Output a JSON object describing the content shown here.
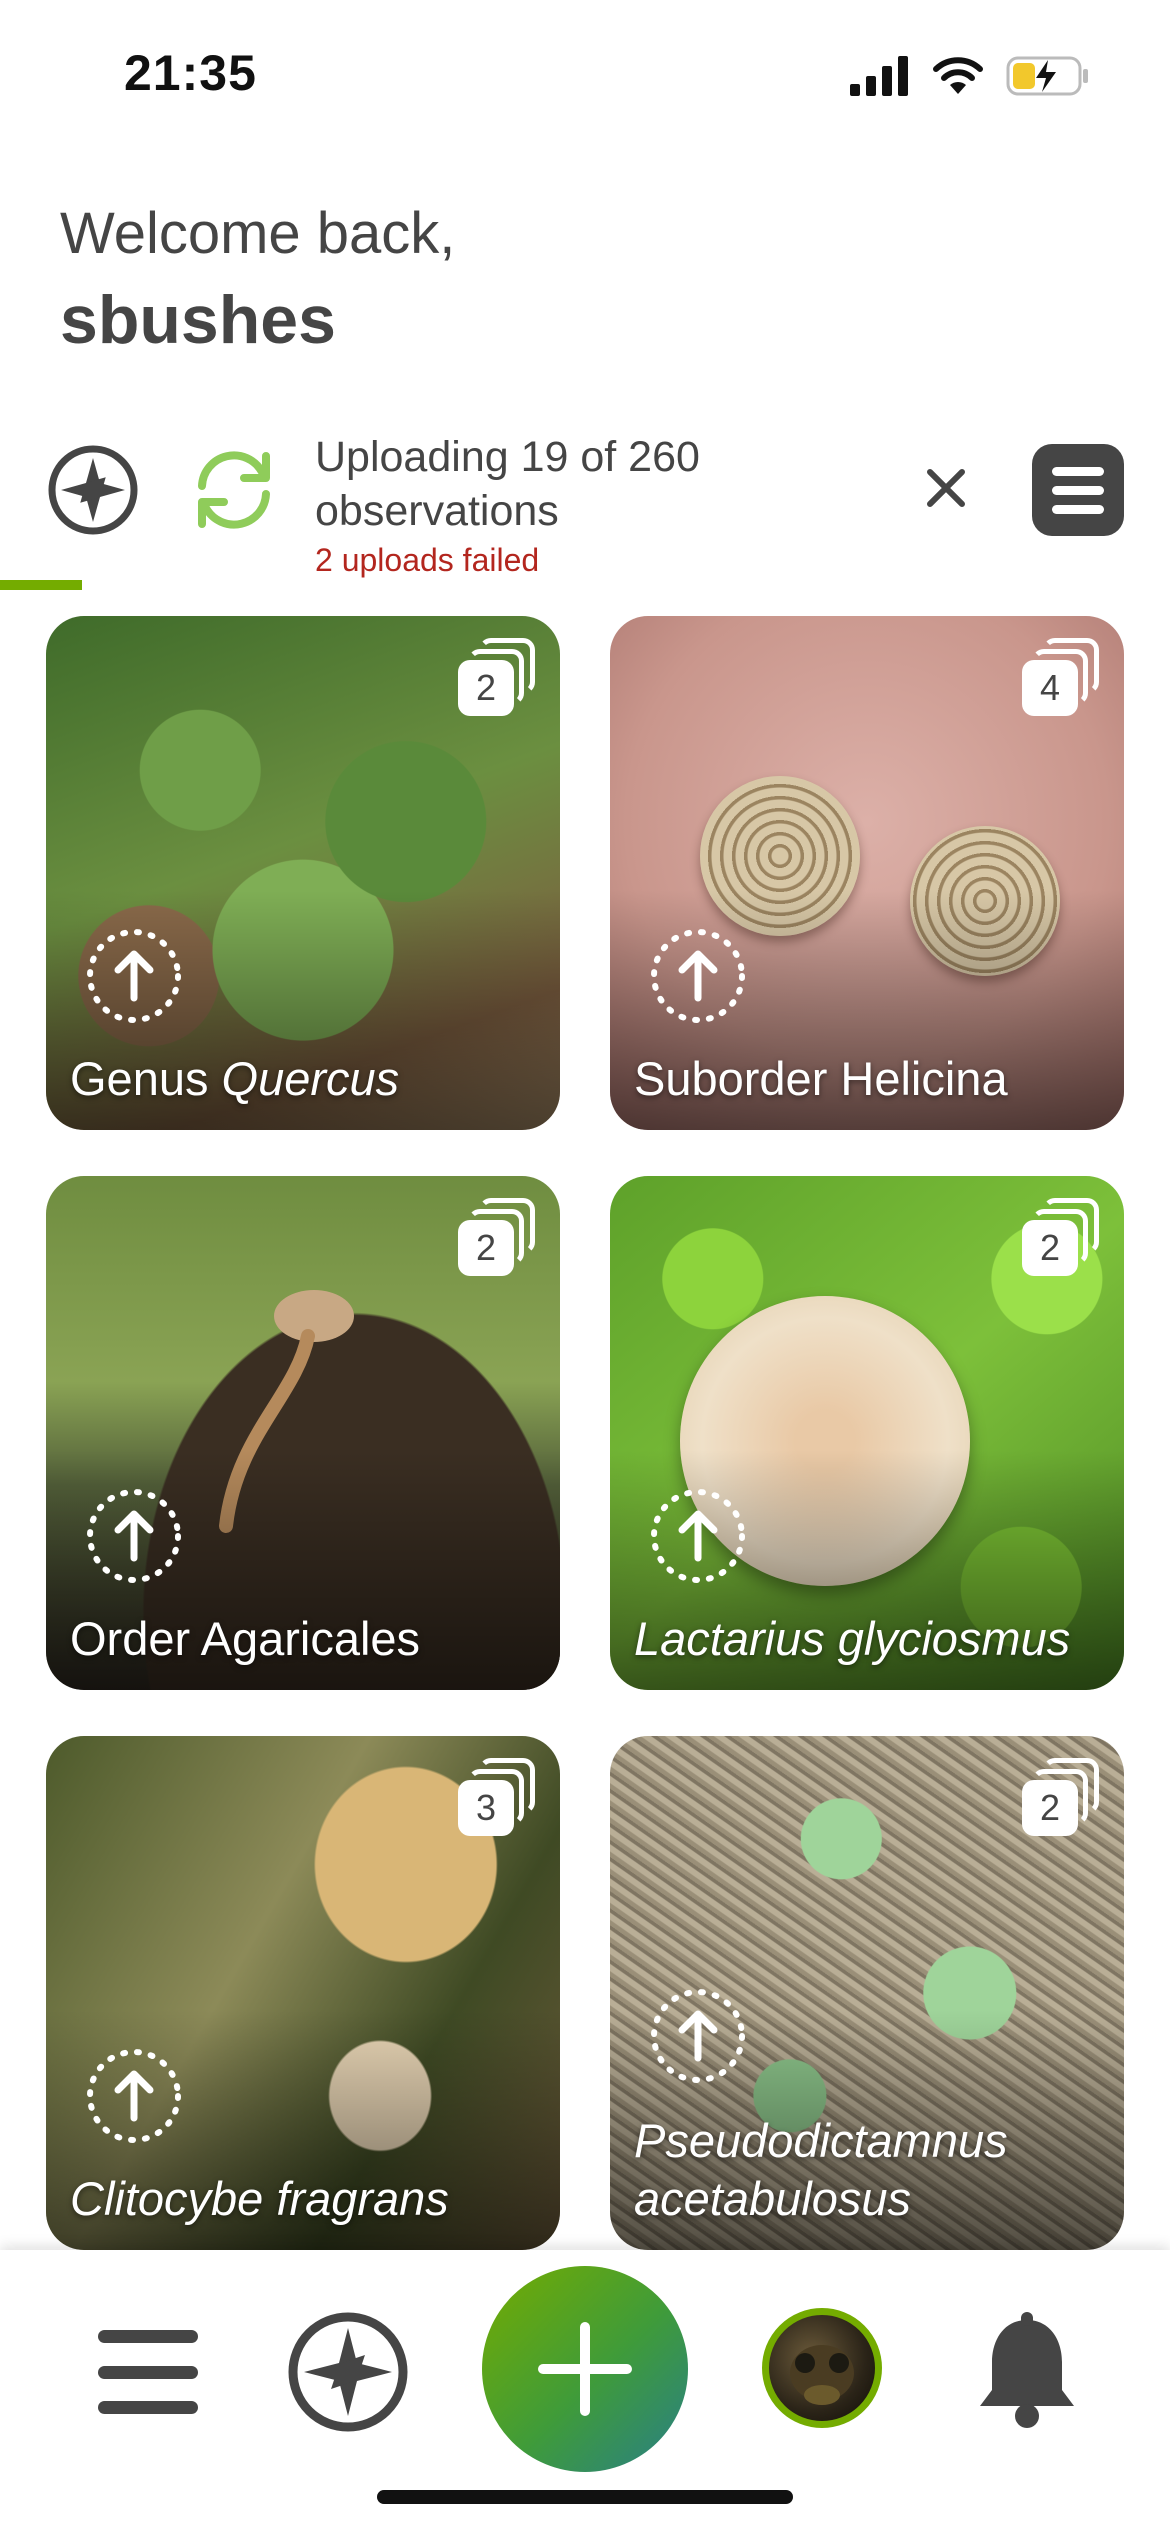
{
  "status_bar": {
    "time": "21:35"
  },
  "welcome": {
    "greeting": "Welcome back,",
    "username": "sbushes"
  },
  "upload": {
    "status_text": "Uploading 19 of 260 observations",
    "failed_text": "2 uploads failed",
    "progress": 0.07
  },
  "colors": {
    "brand_green": "#74ac00",
    "text": "#454545",
    "error": "#b3261e"
  },
  "observations": [
    {
      "rank": "Genus",
      "taxon": "Quercus",
      "photo_count": "2"
    },
    {
      "rank": "Suborder Helicina",
      "taxon": "",
      "photo_count": "4"
    },
    {
      "rank": "Order Agaricales",
      "taxon": "",
      "photo_count": "2"
    },
    {
      "rank": "",
      "taxon": "Lactarius glyciosmus",
      "photo_count": "2"
    },
    {
      "rank": "",
      "taxon": "Clitocybe fragrans",
      "photo_count": "3"
    },
    {
      "rank": "",
      "taxon": "Pseudodictamnus acetabulosus",
      "photo_count": "2"
    }
  ],
  "bottom_nav": {
    "items": [
      "menu-icon",
      "explore-icon",
      "add-observation-icon",
      "user-avatar",
      "notifications-bell-icon"
    ]
  }
}
